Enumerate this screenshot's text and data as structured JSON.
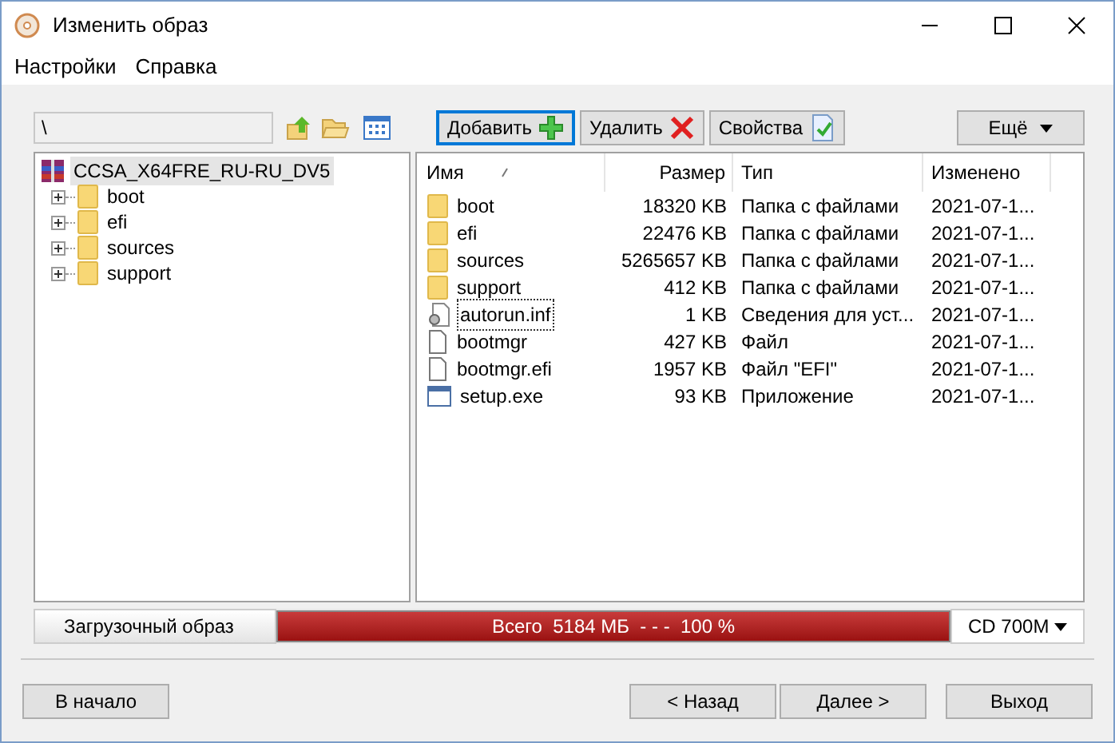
{
  "window": {
    "title": "Изменить образ"
  },
  "menu": [
    "Настройки",
    "Справка"
  ],
  "path": {
    "value": "\\"
  },
  "actions": [
    {
      "label": "Добавить",
      "kind": "add",
      "focused": true
    },
    {
      "label": "Удалить",
      "kind": "delete",
      "focused": false
    },
    {
      "label": "Свойства",
      "kind": "properties",
      "focused": false
    }
  ],
  "more_button": {
    "label": "Ещё"
  },
  "tree": {
    "label": "CCSA_X64FRE_RU-RU_DV5",
    "selected": true,
    "children": [
      {
        "label": "boot",
        "expanded": false,
        "selected": false
      },
      {
        "label": "efi",
        "expanded": false,
        "selected": false
      },
      {
        "label": "sources",
        "expanded": false,
        "selected": false
      },
      {
        "label": "support",
        "expanded": false,
        "selected": false
      }
    ]
  },
  "table": {
    "columns": [
      "Имя",
      "Размер",
      "Тип",
      "Изменено"
    ],
    "rows": [
      {
        "kind": "folder",
        "name": "boot",
        "size": "18320 KB",
        "type": "Папка с файлами",
        "modified": "2021-07-1...",
        "selected": false
      },
      {
        "kind": "folder",
        "name": "efi",
        "size": "22476 KB",
        "type": "Папка с файлами",
        "modified": "2021-07-1...",
        "selected": false
      },
      {
        "kind": "folder",
        "name": "sources",
        "size": "5265657 KB",
        "type": "Папка с файлами",
        "modified": "2021-07-1...",
        "selected": false
      },
      {
        "kind": "folder",
        "name": "support",
        "size": "412 KB",
        "type": "Папка с файлами",
        "modified": "2021-07-1...",
        "selected": false
      },
      {
        "kind": "settings",
        "name": "autorun.inf",
        "size": "1 KB",
        "type": "Сведения для уст...",
        "modified": "2021-07-1...",
        "selected": true
      },
      {
        "kind": "file",
        "name": "bootmgr",
        "size": "427 KB",
        "type": "Файл",
        "modified": "2021-07-1...",
        "selected": false
      },
      {
        "kind": "file",
        "name": "bootmgr.efi",
        "size": "1957 KB",
        "type": "Файл \"EFI\"",
        "modified": "2021-07-1...",
        "selected": false
      },
      {
        "kind": "exe",
        "name": "setup.exe",
        "size": "93 KB",
        "type": "Приложение",
        "modified": "2021-07-1...",
        "selected": false
      }
    ]
  },
  "status": {
    "label": "Загрузочный образ",
    "total": "Всего  5184 МБ  - - -  100 %",
    "level": 1,
    "media": "CD 700M"
  },
  "footer": {
    "left": "В начало",
    "back": "< Назад",
    "next": "Далее >",
    "exit": "Выход"
  }
}
